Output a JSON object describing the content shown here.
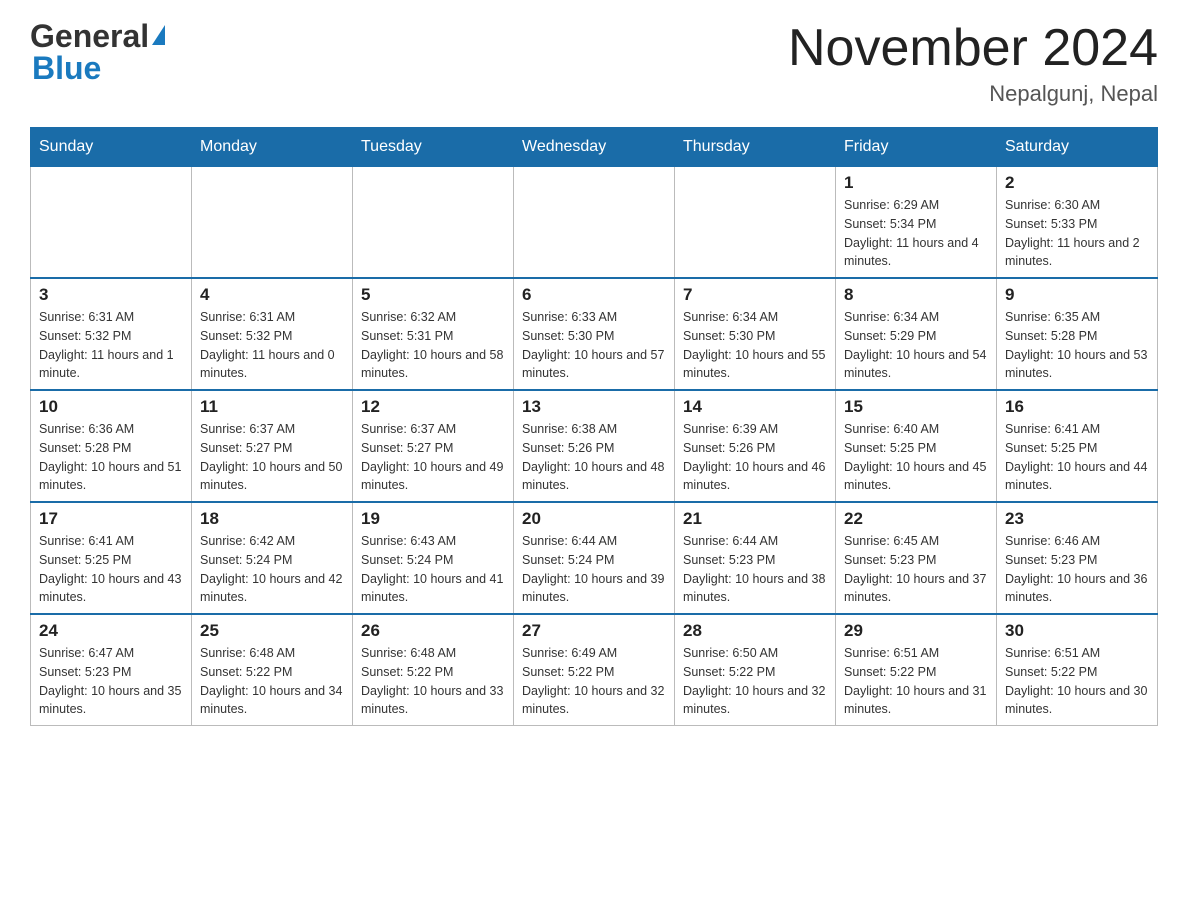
{
  "header": {
    "logo_general": "General",
    "logo_blue": "Blue",
    "month_title": "November 2024",
    "subtitle": "Nepalgunj, Nepal"
  },
  "days_of_week": [
    "Sunday",
    "Monday",
    "Tuesday",
    "Wednesday",
    "Thursday",
    "Friday",
    "Saturday"
  ],
  "weeks": [
    [
      {
        "day": "",
        "info": ""
      },
      {
        "day": "",
        "info": ""
      },
      {
        "day": "",
        "info": ""
      },
      {
        "day": "",
        "info": ""
      },
      {
        "day": "",
        "info": ""
      },
      {
        "day": "1",
        "info": "Sunrise: 6:29 AM\nSunset: 5:34 PM\nDaylight: 11 hours and 4 minutes."
      },
      {
        "day": "2",
        "info": "Sunrise: 6:30 AM\nSunset: 5:33 PM\nDaylight: 11 hours and 2 minutes."
      }
    ],
    [
      {
        "day": "3",
        "info": "Sunrise: 6:31 AM\nSunset: 5:32 PM\nDaylight: 11 hours and 1 minute."
      },
      {
        "day": "4",
        "info": "Sunrise: 6:31 AM\nSunset: 5:32 PM\nDaylight: 11 hours and 0 minutes."
      },
      {
        "day": "5",
        "info": "Sunrise: 6:32 AM\nSunset: 5:31 PM\nDaylight: 10 hours and 58 minutes."
      },
      {
        "day": "6",
        "info": "Sunrise: 6:33 AM\nSunset: 5:30 PM\nDaylight: 10 hours and 57 minutes."
      },
      {
        "day": "7",
        "info": "Sunrise: 6:34 AM\nSunset: 5:30 PM\nDaylight: 10 hours and 55 minutes."
      },
      {
        "day": "8",
        "info": "Sunrise: 6:34 AM\nSunset: 5:29 PM\nDaylight: 10 hours and 54 minutes."
      },
      {
        "day": "9",
        "info": "Sunrise: 6:35 AM\nSunset: 5:28 PM\nDaylight: 10 hours and 53 minutes."
      }
    ],
    [
      {
        "day": "10",
        "info": "Sunrise: 6:36 AM\nSunset: 5:28 PM\nDaylight: 10 hours and 51 minutes."
      },
      {
        "day": "11",
        "info": "Sunrise: 6:37 AM\nSunset: 5:27 PM\nDaylight: 10 hours and 50 minutes."
      },
      {
        "day": "12",
        "info": "Sunrise: 6:37 AM\nSunset: 5:27 PM\nDaylight: 10 hours and 49 minutes."
      },
      {
        "day": "13",
        "info": "Sunrise: 6:38 AM\nSunset: 5:26 PM\nDaylight: 10 hours and 48 minutes."
      },
      {
        "day": "14",
        "info": "Sunrise: 6:39 AM\nSunset: 5:26 PM\nDaylight: 10 hours and 46 minutes."
      },
      {
        "day": "15",
        "info": "Sunrise: 6:40 AM\nSunset: 5:25 PM\nDaylight: 10 hours and 45 minutes."
      },
      {
        "day": "16",
        "info": "Sunrise: 6:41 AM\nSunset: 5:25 PM\nDaylight: 10 hours and 44 minutes."
      }
    ],
    [
      {
        "day": "17",
        "info": "Sunrise: 6:41 AM\nSunset: 5:25 PM\nDaylight: 10 hours and 43 minutes."
      },
      {
        "day": "18",
        "info": "Sunrise: 6:42 AM\nSunset: 5:24 PM\nDaylight: 10 hours and 42 minutes."
      },
      {
        "day": "19",
        "info": "Sunrise: 6:43 AM\nSunset: 5:24 PM\nDaylight: 10 hours and 41 minutes."
      },
      {
        "day": "20",
        "info": "Sunrise: 6:44 AM\nSunset: 5:24 PM\nDaylight: 10 hours and 39 minutes."
      },
      {
        "day": "21",
        "info": "Sunrise: 6:44 AM\nSunset: 5:23 PM\nDaylight: 10 hours and 38 minutes."
      },
      {
        "day": "22",
        "info": "Sunrise: 6:45 AM\nSunset: 5:23 PM\nDaylight: 10 hours and 37 minutes."
      },
      {
        "day": "23",
        "info": "Sunrise: 6:46 AM\nSunset: 5:23 PM\nDaylight: 10 hours and 36 minutes."
      }
    ],
    [
      {
        "day": "24",
        "info": "Sunrise: 6:47 AM\nSunset: 5:23 PM\nDaylight: 10 hours and 35 minutes."
      },
      {
        "day": "25",
        "info": "Sunrise: 6:48 AM\nSunset: 5:22 PM\nDaylight: 10 hours and 34 minutes."
      },
      {
        "day": "26",
        "info": "Sunrise: 6:48 AM\nSunset: 5:22 PM\nDaylight: 10 hours and 33 minutes."
      },
      {
        "day": "27",
        "info": "Sunrise: 6:49 AM\nSunset: 5:22 PM\nDaylight: 10 hours and 32 minutes."
      },
      {
        "day": "28",
        "info": "Sunrise: 6:50 AM\nSunset: 5:22 PM\nDaylight: 10 hours and 32 minutes."
      },
      {
        "day": "29",
        "info": "Sunrise: 6:51 AM\nSunset: 5:22 PM\nDaylight: 10 hours and 31 minutes."
      },
      {
        "day": "30",
        "info": "Sunrise: 6:51 AM\nSunset: 5:22 PM\nDaylight: 10 hours and 30 minutes."
      }
    ]
  ]
}
